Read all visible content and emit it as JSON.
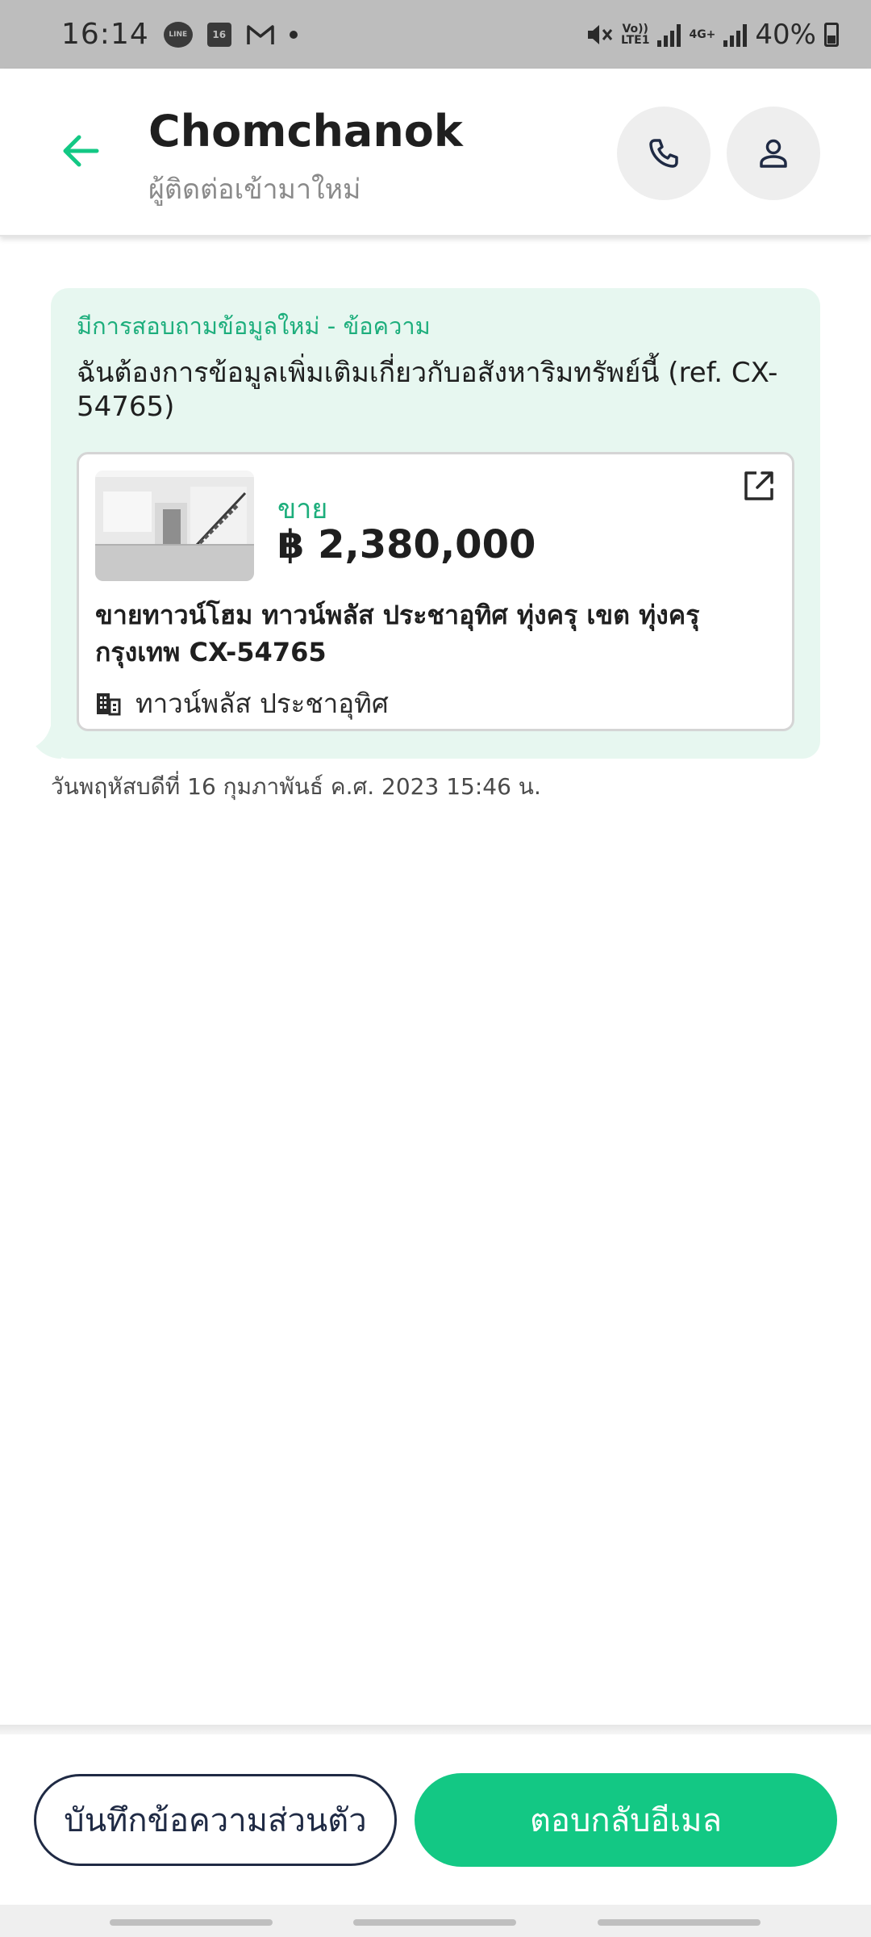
{
  "status_bar": {
    "time": "16:14",
    "calendar_day": "16",
    "line_label": "LINE",
    "volte_label": "Vo))\nLTE1",
    "network_label": "4G+",
    "battery": "40%"
  },
  "header": {
    "title": "Chomchanok",
    "subtitle": "ผู้ติดต่อเข้ามาใหม่"
  },
  "message": {
    "label": "มีการสอบถามข้อมูลใหม่ - ข้อความ",
    "text": "ฉันต้องการข้อมูลเพิ่มเติมเกี่ยวกับอสังหาริมทรัพย์นี้ (ref. CX-54765)",
    "timestamp": "วันพฤหัสบดีที่ 16 กุมภาพันธ์ ค.ศ. 2023 15:46 น."
  },
  "listing": {
    "type": "ขาย",
    "price": "฿ 2,380,000",
    "title": "ขายทาวน์โฮม  ทาวน์พลัส ประชาอุทิศ ทุ่งครุ เขต ทุ่งครุ กรุงเทพ CX-54765",
    "project": "ทาวน์พลัส ประชาอุทิศ"
  },
  "actions": {
    "note_label": "บันทึกข้อความส่วนตัว",
    "reply_label": "ตอบกลับอีเมล"
  },
  "colors": {
    "accent": "#13c884",
    "accent_text": "#1dae7c",
    "bubble": "#e7f7f0",
    "status_bar": "#bdbdbd"
  },
  "icons": {
    "back": "arrow-left-icon",
    "call": "phone-icon",
    "profile": "person-icon",
    "open": "external-link-icon",
    "project": "building-icon"
  }
}
